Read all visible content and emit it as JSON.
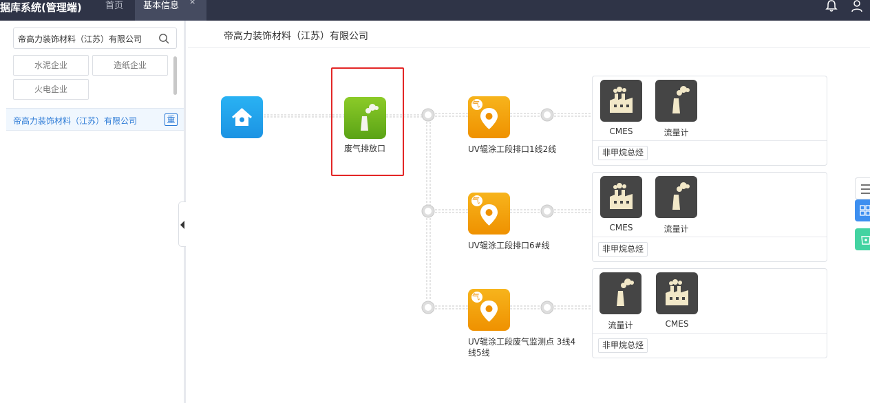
{
  "app": {
    "title": "据库系统(管理端)"
  },
  "tabs": [
    {
      "label": "首页",
      "active": false
    },
    {
      "label": "基本信息",
      "active": true,
      "close": "×"
    }
  ],
  "header_icons": [
    "bell-icon",
    "user-icon"
  ],
  "sidebar": {
    "search": {
      "value": "帝高力装饰材料（江苏）有限公司",
      "icon": "search-icon"
    },
    "filters": [
      "水泥企业",
      "造纸企业",
      "火电企业"
    ],
    "companies": [
      {
        "name": "帝高力装饰材料（江苏）有限公司",
        "tag": "重"
      }
    ]
  },
  "main": {
    "title": "帝高力装饰材料（江苏）有限公司",
    "root": {
      "icon": "house-icon"
    },
    "outlet": {
      "label": "废气排放口",
      "icon": "chimney-icon",
      "highlighted": true
    },
    "monitor_points": [
      {
        "badge": "气",
        "label_lines": [
          "UV辊涂工段排口1线2线"
        ],
        "devices": [
          {
            "label": "CMES",
            "icon": "factory-icon"
          },
          {
            "label": "流量计",
            "icon": "chimney-icon"
          }
        ],
        "tags": [
          "非甲烷总烃"
        ]
      },
      {
        "badge": "气",
        "label_lines": [
          "UV辊涂工段排口6#线"
        ],
        "devices": [
          {
            "label": "CMES",
            "icon": "factory-icon"
          },
          {
            "label": "流量计",
            "icon": "chimney-icon"
          }
        ],
        "tags": [
          "非甲烷总烃"
        ]
      },
      {
        "badge": "气",
        "label_lines": [
          "UV辊涂工段废气监测点 3线4",
          "线5线"
        ],
        "devices": [
          {
            "label": "流量计",
            "icon": "chimney-icon"
          },
          {
            "label": "CMES",
            "icon": "factory-icon"
          }
        ],
        "tags": [
          "非甲烷总烃"
        ]
      }
    ]
  },
  "colors": {
    "topbar": "#2f3447",
    "active_tab": "#454b60",
    "link_blue": "#2b7ad6",
    "highlight_red": "#e32626",
    "home_blue": "#1c93e3",
    "outlet_green": "#5aa316",
    "point_orange": "#ef9100",
    "device_dark": "#454545"
  },
  "right_toolbar": [
    "list-icon",
    "grid-icon",
    "bin-icon"
  ]
}
